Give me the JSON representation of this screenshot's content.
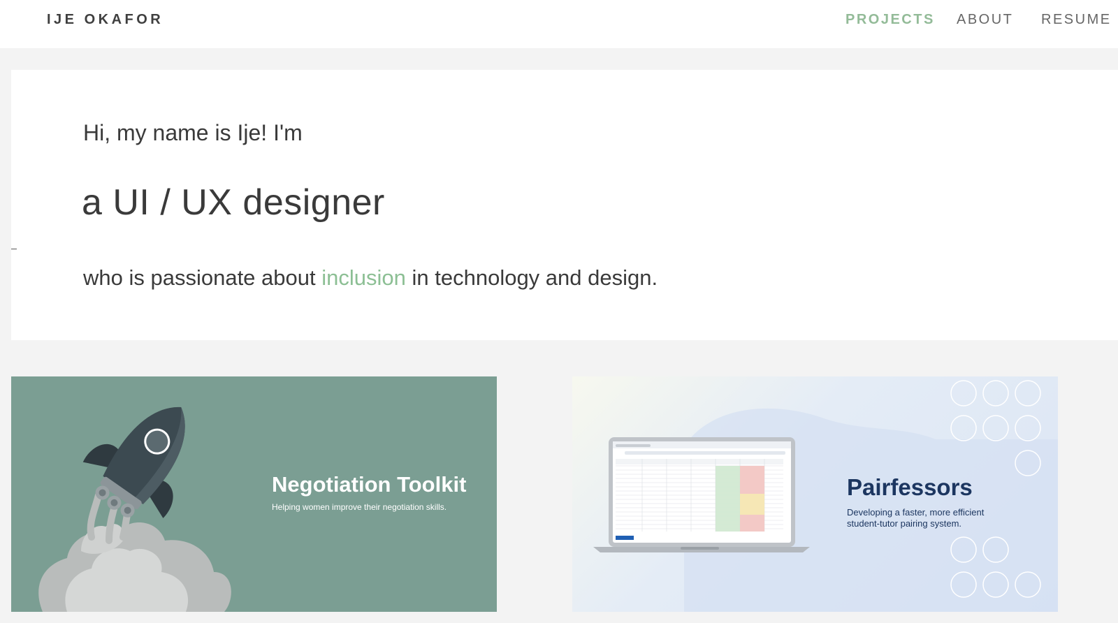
{
  "header": {
    "brand": "IJE OKAFOR",
    "nav": [
      {
        "label": "PROJECTS",
        "active": true
      },
      {
        "label": "ABOUT",
        "active": false
      },
      {
        "label": "RESUME",
        "active": false
      }
    ]
  },
  "hero": {
    "greeting": "Hi, my name is Ije! I'm",
    "role": "a UI / UX designer",
    "passion_before": "who is passionate about",
    "passion_accent": "inclusion",
    "passion_after": "in technology and design."
  },
  "projects": [
    {
      "title": "Negotiation Toolkit",
      "subtitle": "Helping women improve their negotiation skills.",
      "illustration": "rocket-illustration",
      "background": "#7b9e93"
    },
    {
      "title": "Pairfessors",
      "subtitle": "Developing a faster, more efficient student-tutor pairing system.",
      "illustration": "laptop-spreadsheet-illustration",
      "background": "#dbe5f4"
    }
  ],
  "colors": {
    "accent": "#8cbf94",
    "nav_active": "#93bb98",
    "pair_title": "#1c3660"
  }
}
